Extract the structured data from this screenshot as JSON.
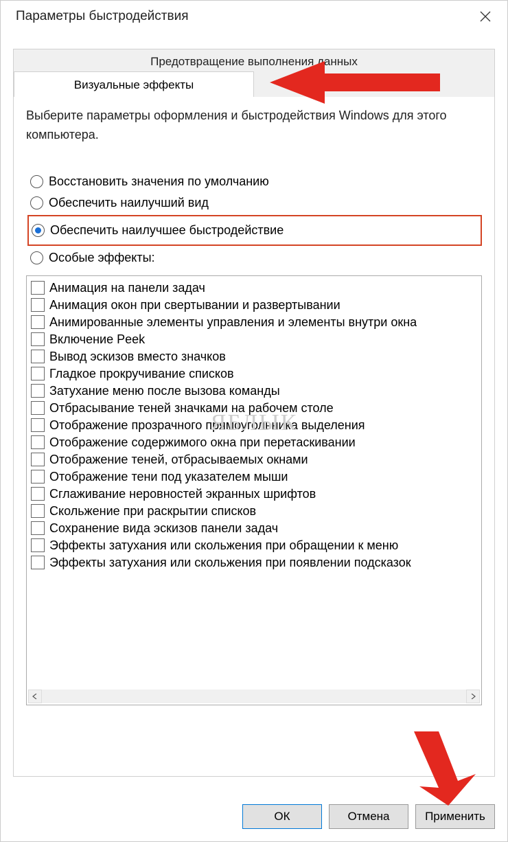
{
  "window": {
    "title": "Параметры быстродействия"
  },
  "tabs": {
    "back": "Предотвращение выполнения данных",
    "front": "Визуальные эффекты"
  },
  "intro": "Выберите параметры оформления и быстродействия Windows для этого компьютера.",
  "radios": [
    {
      "label": "Восстановить значения по умолчанию",
      "checked": false
    },
    {
      "label": "Обеспечить наилучший вид",
      "checked": false
    },
    {
      "label": "Обеспечить наилучшее быстродействие",
      "checked": true,
      "highlight": true
    },
    {
      "label": "Особые эффекты:",
      "checked": false
    }
  ],
  "effects": [
    "Анимация на панели задач",
    "Анимация окон при свертывании и развертывании",
    "Анимированные элементы управления и элементы внутри окна",
    "Включение Peek",
    "Вывод эскизов вместо значков",
    "Гладкое прокручивание списков",
    "Затухание меню после вызова команды",
    "Отбрасывание теней значками на рабочем столе",
    "Отображение прозрачного прямоугольника выделения",
    "Отображение содержимого окна при перетаскивании",
    "Отображение теней, отбрасываемых окнами",
    "Отображение тени под указателем мыши",
    "Сглаживание неровностей экранных шрифтов",
    "Скольжение при раскрытии списков",
    "Сохранение вида эскизов панели задач",
    "Эффекты затухания или скольжения при обращении к меню",
    "Эффекты затухания или скольжения при появлении подсказок"
  ],
  "buttons": {
    "ok": "ОК",
    "cancel": "Отмена",
    "apply": "Применить"
  },
  "watermark": "ЯБЛЫК"
}
